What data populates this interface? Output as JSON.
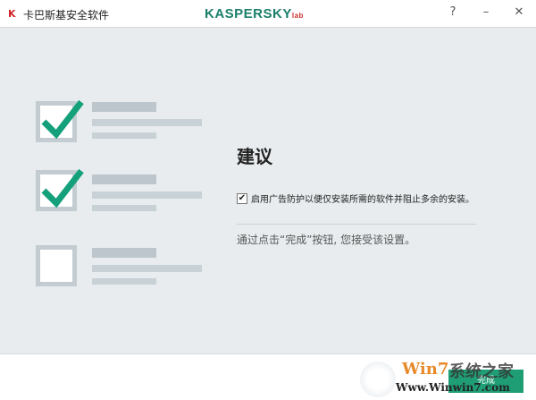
{
  "window": {
    "title": "卡巴斯基安全软件",
    "logo": "KASPERSKY",
    "logo_suffix": "lab",
    "help": "?",
    "minimize": "–",
    "close": "✕"
  },
  "main": {
    "heading": "建议",
    "option": {
      "label": "启用广告防护以便仅安装所需的软件并阻止多余的安装。",
      "checked": true
    },
    "hint": "通过点击“完成”按钮, 您接受该设置。"
  },
  "footer": {
    "done_label": "完成"
  },
  "watermark": {
    "brand": "Win7",
    "cn": "系统之家",
    "url": "Www.Winwin7.com"
  },
  "colors": {
    "accent": "#1f9e75",
    "check": "#14a07a"
  }
}
